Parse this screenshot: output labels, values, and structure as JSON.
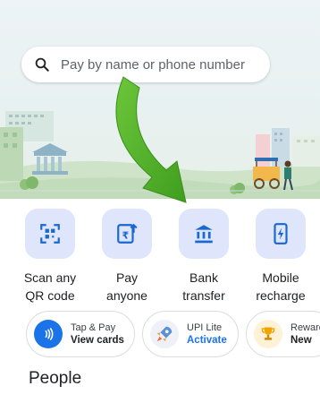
{
  "search": {
    "placeholder": "Pay by name or phone number",
    "icon": "search-icon"
  },
  "actions": [
    {
      "line1": "Scan any",
      "line2": "QR code",
      "icon": "qr-scan-icon"
    },
    {
      "line1": "Pay",
      "line2": "anyone",
      "icon": "send-money-icon"
    },
    {
      "line1": "Bank",
      "line2": "transfer",
      "icon": "bank-icon"
    },
    {
      "line1": "Mobile",
      "line2": "recharge",
      "icon": "mobile-recharge-icon"
    }
  ],
  "chips": [
    {
      "top": "Tap & Pay",
      "bottom": "View cards",
      "icon": "nfc-icon"
    },
    {
      "top": "UPI Lite",
      "bottom": "Activate",
      "icon": "rocket-icon"
    },
    {
      "top": "Rewards",
      "bottom": "New",
      "icon": "trophy-icon"
    }
  ],
  "section": {
    "people": "People"
  },
  "colors": {
    "tile_bg": "#dfe6fb",
    "icon_blue": "#1967d2",
    "link_blue": "#1a73e8",
    "arrow_green": "#55b62a"
  }
}
